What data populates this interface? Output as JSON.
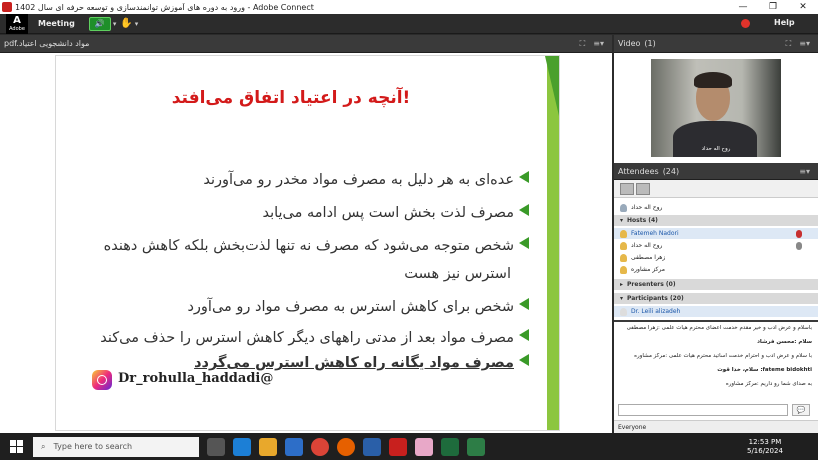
{
  "window": {
    "title": "ورود به دوره های آموزش توانمندسازی و توسعه حرفه ای سال 1402 - Adobe Connect",
    "minimize": "—",
    "maximize": "❐",
    "close": "✕"
  },
  "menubar": {
    "logo_letter": "A",
    "logo_word": "Adobe",
    "meeting": "Meeting",
    "help": "Help"
  },
  "share_pod": {
    "title": "pdf.مواد دانشجویی اعتیاد",
    "slide": {
      "title": "آنچه در اعتیاد اتفاق می‌افتد!",
      "bullets": [
        "عده‌ای به هر دلیل به مصرف مواد مخدر رو می‌آورند",
        "مصرف لذت بخش است پس ادامه می‌یابد",
        "شخص متوجه می‌شود که مصرف نه تنها لذت‌بخش بلکه کاهش دهنده",
        "استرس نیز هست",
        "شخص برای کاهش استرس به مصرف مواد رو می‌آورد",
        "مصرف مواد بعد از مدتی راههای دیگر کاهش استرس را حذف می‌کند",
        "مصرف مواد یگانه راه کاهش استرس می‌گردد"
      ],
      "handle": "Dr_rohulla_haddadi@"
    }
  },
  "video_pod": {
    "title": "Video",
    "count": "(1)",
    "caption": "روح اله حداد"
  },
  "attendees_pod": {
    "title": "Attendees",
    "count": "(24)",
    "presenter_row": "روح اله حداد",
    "hosts_label": "Hosts (4)",
    "hosts": [
      "Fatemeh Nadori",
      "روح اله حداد",
      "زهرا مصطفی",
      "مرکز مشاوره"
    ],
    "presenters_label": "Presenters (0)",
    "participants_label": "Participants (20)",
    "participants": [
      "Dr. Leili alizadeh"
    ]
  },
  "chat_pod": {
    "messages": [
      "باسلام و عرض ادب و خیر مقدم خدمت اعضای محترم هیات علمی :زهرا مصطفی",
      "سلام :محسن فرشاد",
      "با سلام و عرض ادب و احترام خدمت اساتید محترم هیات علمی :مرکز مشاوره",
      "fateme bidokhti: سلام، خدا قوت",
      "به صدای شما رو داریم :مرکز مشاوره"
    ],
    "recipient": "Everyone"
  },
  "taskbar": {
    "search_placeholder": "Type here to search",
    "time": "12:53 PM",
    "date": "5/16/2024"
  }
}
